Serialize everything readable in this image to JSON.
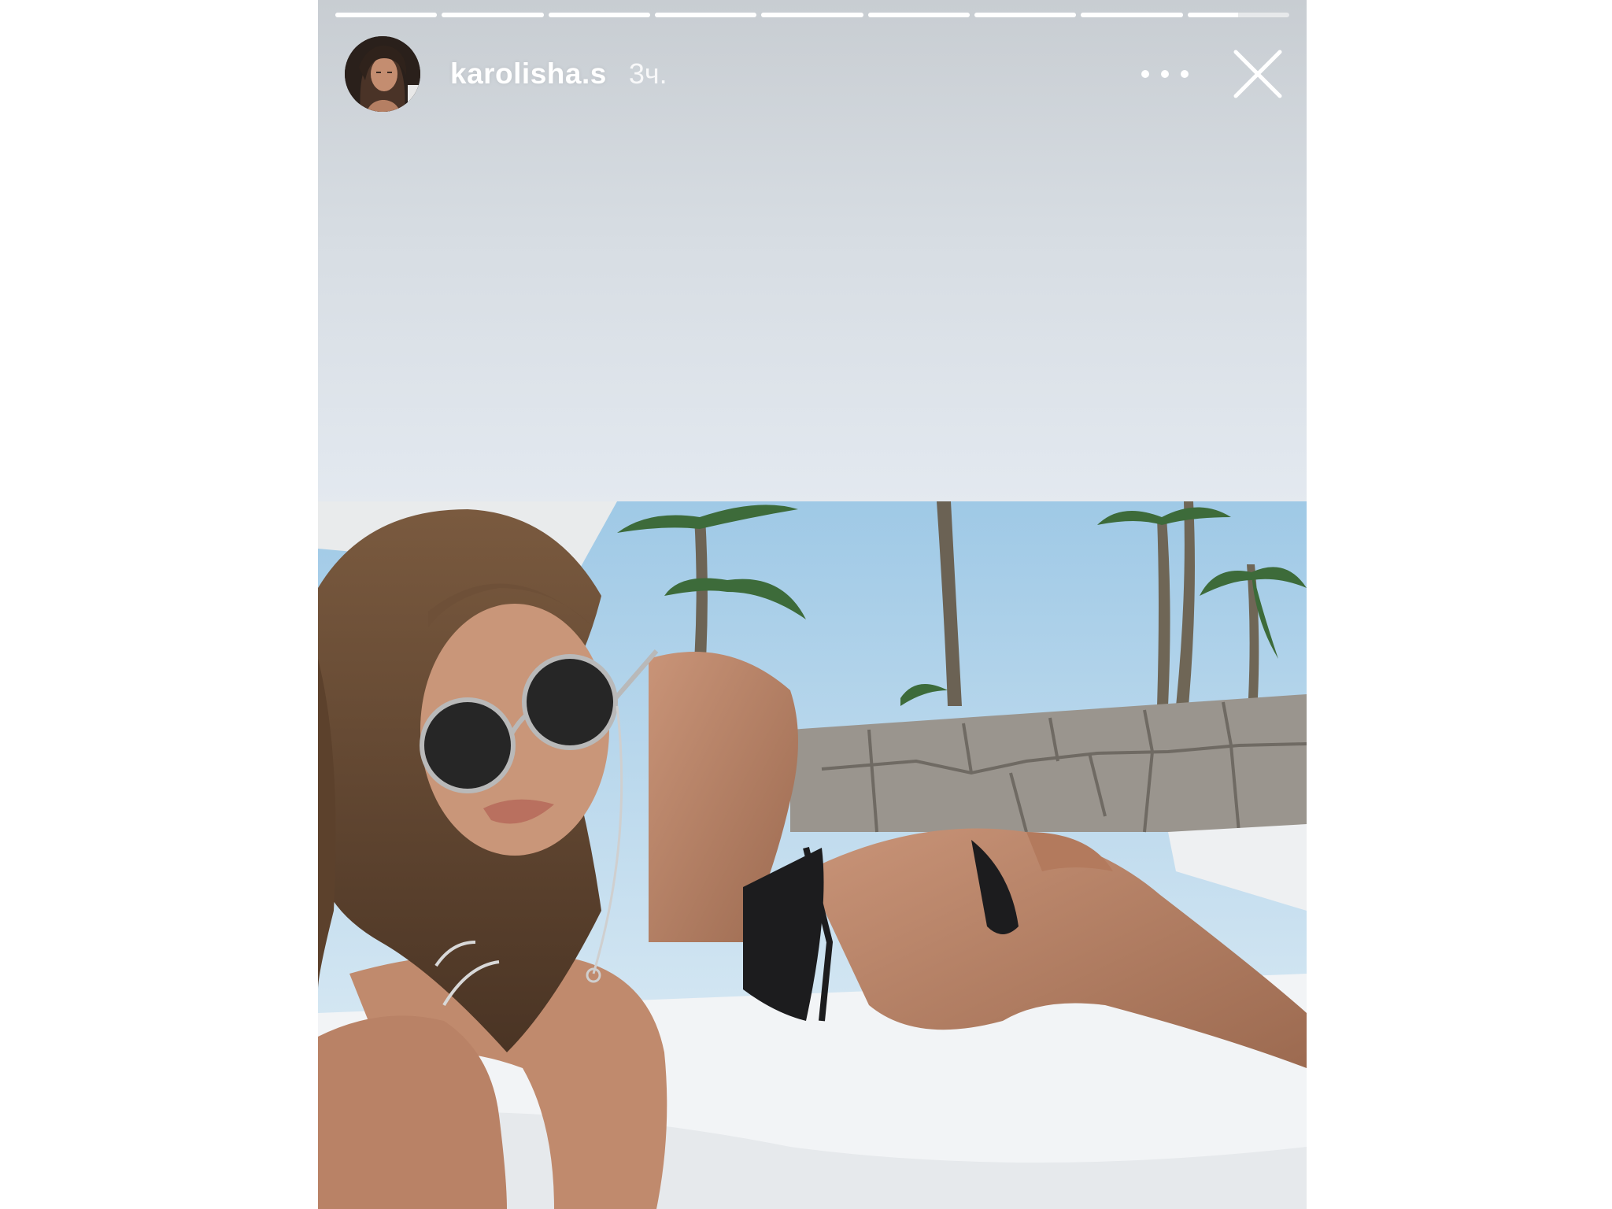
{
  "story": {
    "username": "karolisha.s",
    "time_ago": "3ч.",
    "segment_count": 9,
    "current_segment_progress": 0.5,
    "more_icon": "ellipsis-icon",
    "close_icon": "close-icon"
  },
  "colors": {
    "top_gradient_start": "#c8cdd2",
    "top_gradient_end": "#e4e9ef",
    "sky": "#a9d0ea",
    "towel": "#f4f6f8",
    "bikini": "#1c1c1e"
  }
}
